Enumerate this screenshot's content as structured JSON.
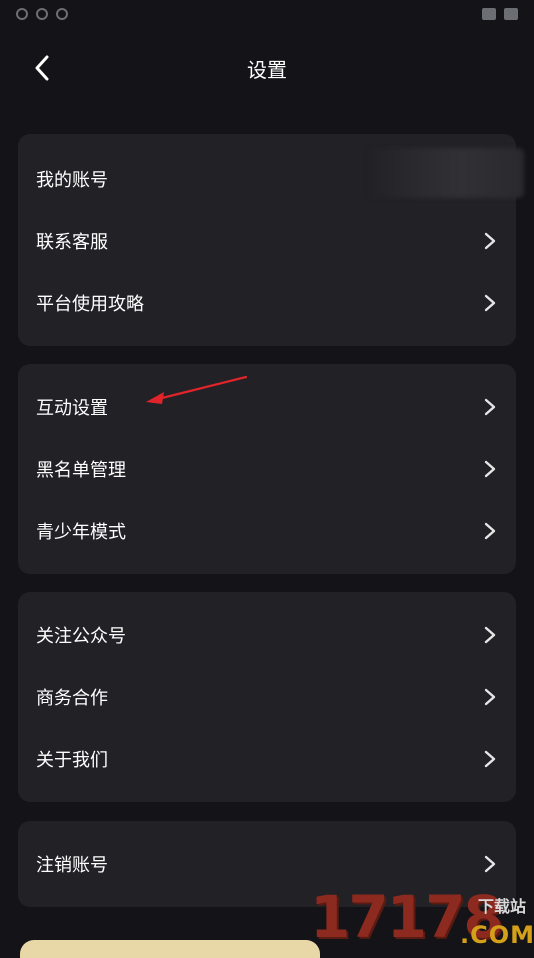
{
  "header": {
    "title": "设置"
  },
  "groups": [
    {
      "items": [
        {
          "label": "我的账号"
        },
        {
          "label": "联系客服"
        },
        {
          "label": "平台使用攻略"
        }
      ]
    },
    {
      "items": [
        {
          "label": "互动设置"
        },
        {
          "label": "黑名单管理"
        },
        {
          "label": "青少年模式"
        }
      ]
    },
    {
      "items": [
        {
          "label": "关注公众号"
        },
        {
          "label": "商务合作"
        },
        {
          "label": "关于我们"
        }
      ]
    },
    {
      "items": [
        {
          "label": "注销账号"
        }
      ]
    }
  ],
  "watermark": {
    "number": "17178",
    "site": "下载站",
    "domain": ".COM"
  },
  "colors": {
    "background": "#141318",
    "card": "#222126",
    "text": "#ffffff",
    "annotation_arrow": "#e0242a"
  },
  "icons": {
    "back": "chevron-left-icon",
    "row": "chevron-right-icon"
  }
}
